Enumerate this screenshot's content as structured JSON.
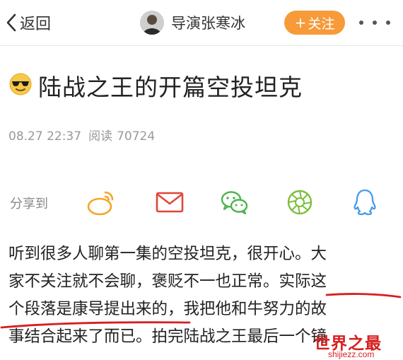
{
  "header": {
    "back_label": "返回",
    "author_name": "导演张寒冰",
    "follow_label": "关注",
    "follow_plus": "+"
  },
  "post": {
    "title": "陆战之王的开篇空投坦克",
    "date": "08.27 22:37",
    "reads_label": "阅读",
    "reads_count": "70724"
  },
  "share": {
    "label": "分享到",
    "targets": [
      "weibo-icon",
      "mail-icon",
      "wechat-icon",
      "moments-icon",
      "qq-icon"
    ]
  },
  "content": {
    "lines": [
      "听到很多人聊第一集的空投坦克，很开心。大",
      "家不关注就不会聊，褒贬不一也正常。实际这",
      "个段落是康导提出来的，我把他和牛努力的故",
      "事结合起来了而已。拍完陆战之王最后一个镜"
    ]
  },
  "watermark": {
    "main": "世界之最",
    "sub": "shijiezz.com"
  },
  "colors": {
    "follow_bg": "#f69a3a",
    "weibo": "#f5a623",
    "mail": "#e0463a",
    "wechat": "#4fb34f",
    "moments": "#7cbf3a",
    "qq": "#4a9be8",
    "annotation": "#d81e1e"
  }
}
